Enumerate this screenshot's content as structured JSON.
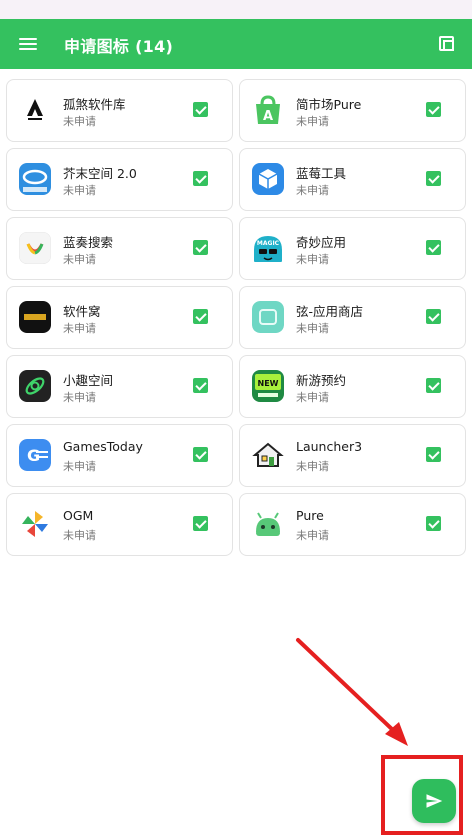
{
  "app_bar": {
    "title": "申请图标 (14)"
  },
  "apps": [
    {
      "name": "孤煞软件库",
      "status": "未申请",
      "checked": true,
      "icon": "gusha-logo-icon"
    },
    {
      "name": "简市场Pure",
      "status": "未申请",
      "checked": true,
      "icon": "jian-market-icon"
    },
    {
      "name": "芥末空间 2.0",
      "status": "未申请",
      "checked": true,
      "icon": "jiemo-space-icon"
    },
    {
      "name": "蓝莓工具",
      "status": "未申请",
      "checked": true,
      "icon": "lanmei-tool-icon"
    },
    {
      "name": "蓝奏搜索",
      "status": "未申请",
      "checked": true,
      "icon": "lanzou-search-icon"
    },
    {
      "name": "奇妙应用",
      "status": "未申请",
      "checked": true,
      "icon": "magic-app-icon"
    },
    {
      "name": "软件窝",
      "status": "未申请",
      "checked": true,
      "icon": "ruanjianwo-icon"
    },
    {
      "name": "弦-应用商店",
      "status": "未申请",
      "checked": true,
      "icon": "xian-store-icon"
    },
    {
      "name": "小趣空间",
      "status": "未申请",
      "checked": true,
      "icon": "xiaoqu-space-icon"
    },
    {
      "name": "新游预约",
      "status": "未申请",
      "checked": true,
      "icon": "new-game-icon"
    },
    {
      "name": "GamesToday",
      "status": "未申请",
      "checked": true,
      "icon": "gamestoday-icon"
    },
    {
      "name": "Launcher3",
      "status": "未申请",
      "checked": true,
      "icon": "launcher-house-icon"
    },
    {
      "name": "OGM",
      "status": "未申请",
      "checked": true,
      "icon": "pinwheel-icon"
    },
    {
      "name": "Pure",
      "status": "未申请",
      "checked": true,
      "icon": "android-robot-icon"
    }
  ],
  "colors": {
    "accent": "#34c15f",
    "annotation": "#e52020"
  }
}
